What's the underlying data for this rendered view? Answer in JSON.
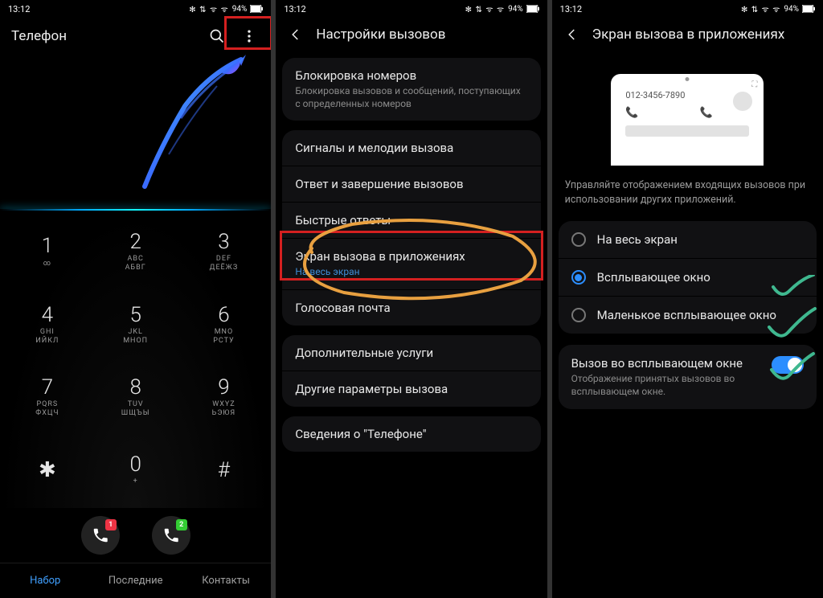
{
  "status": {
    "time": "13:12",
    "battery": "94%",
    "icons_text": "✻ ⇅ ᯤ ᯤ"
  },
  "screen1": {
    "title": "Телефон",
    "keys": [
      {
        "d": "1",
        "lat": "",
        "cyr": "∞"
      },
      {
        "d": "2",
        "lat": "ABC",
        "cyr": "АБВГ"
      },
      {
        "d": "3",
        "lat": "DEF",
        "cyr": "ДЕЁЖЗ"
      },
      {
        "d": "4",
        "lat": "GHI",
        "cyr": "ИЙКЛ"
      },
      {
        "d": "5",
        "lat": "JKL",
        "cyr": "МНОП"
      },
      {
        "d": "6",
        "lat": "MNO",
        "cyr": "РСТУ"
      },
      {
        "d": "7",
        "lat": "PQRS",
        "cyr": "ФХЦЧ"
      },
      {
        "d": "8",
        "lat": "TUV",
        "cyr": "ШЩЪЫ"
      },
      {
        "d": "9",
        "lat": "WXYZ",
        "cyr": "ЬЭЮЯ"
      },
      {
        "d": "✱",
        "lat": "",
        "cyr": ""
      },
      {
        "d": "0",
        "lat": "+",
        "cyr": ""
      },
      {
        "d": "#",
        "lat": "",
        "cyr": ""
      }
    ],
    "sim1_badge": "1",
    "sim2_badge": "2",
    "tabs": {
      "dial": "Набор",
      "recent": "Последние",
      "contacts": "Контакты"
    }
  },
  "screen2": {
    "title": "Настройки вызовов",
    "block": {
      "t": "Блокировка номеров",
      "s": "Блокировка вызовов и сообщений, поступающих с определенных номеров"
    },
    "rows": [
      {
        "t": "Сигналы и мелодии вызова"
      },
      {
        "t": "Ответ и завершение вызовов"
      },
      {
        "t": "Быстрые ответы"
      },
      {
        "t": "Экран вызова в приложениях",
        "s": "На весь экран",
        "accent": true
      },
      {
        "t": "Голосовая почта"
      }
    ],
    "extra": {
      "t": "Дополнительные услуги"
    },
    "other": {
      "t": "Другие параметры вызова"
    },
    "about": {
      "t": "Сведения о \"Телефоне\""
    }
  },
  "screen3": {
    "title": "Экран вызова в приложениях",
    "preview_number": "012-3456-7890",
    "desc": "Управляйте отображением входящих вызовов при использовании других приложений.",
    "radios": [
      {
        "label": "На весь экран",
        "checked": false
      },
      {
        "label": "Всплывающее окно",
        "checked": true
      },
      {
        "label": "Маленькое всплывающее окно",
        "checked": false
      }
    ],
    "toggle": {
      "t": "Вызов во всплывающем окне",
      "s": "Отображение принятых вызовов во всплывающем окне.",
      "on": true
    }
  }
}
